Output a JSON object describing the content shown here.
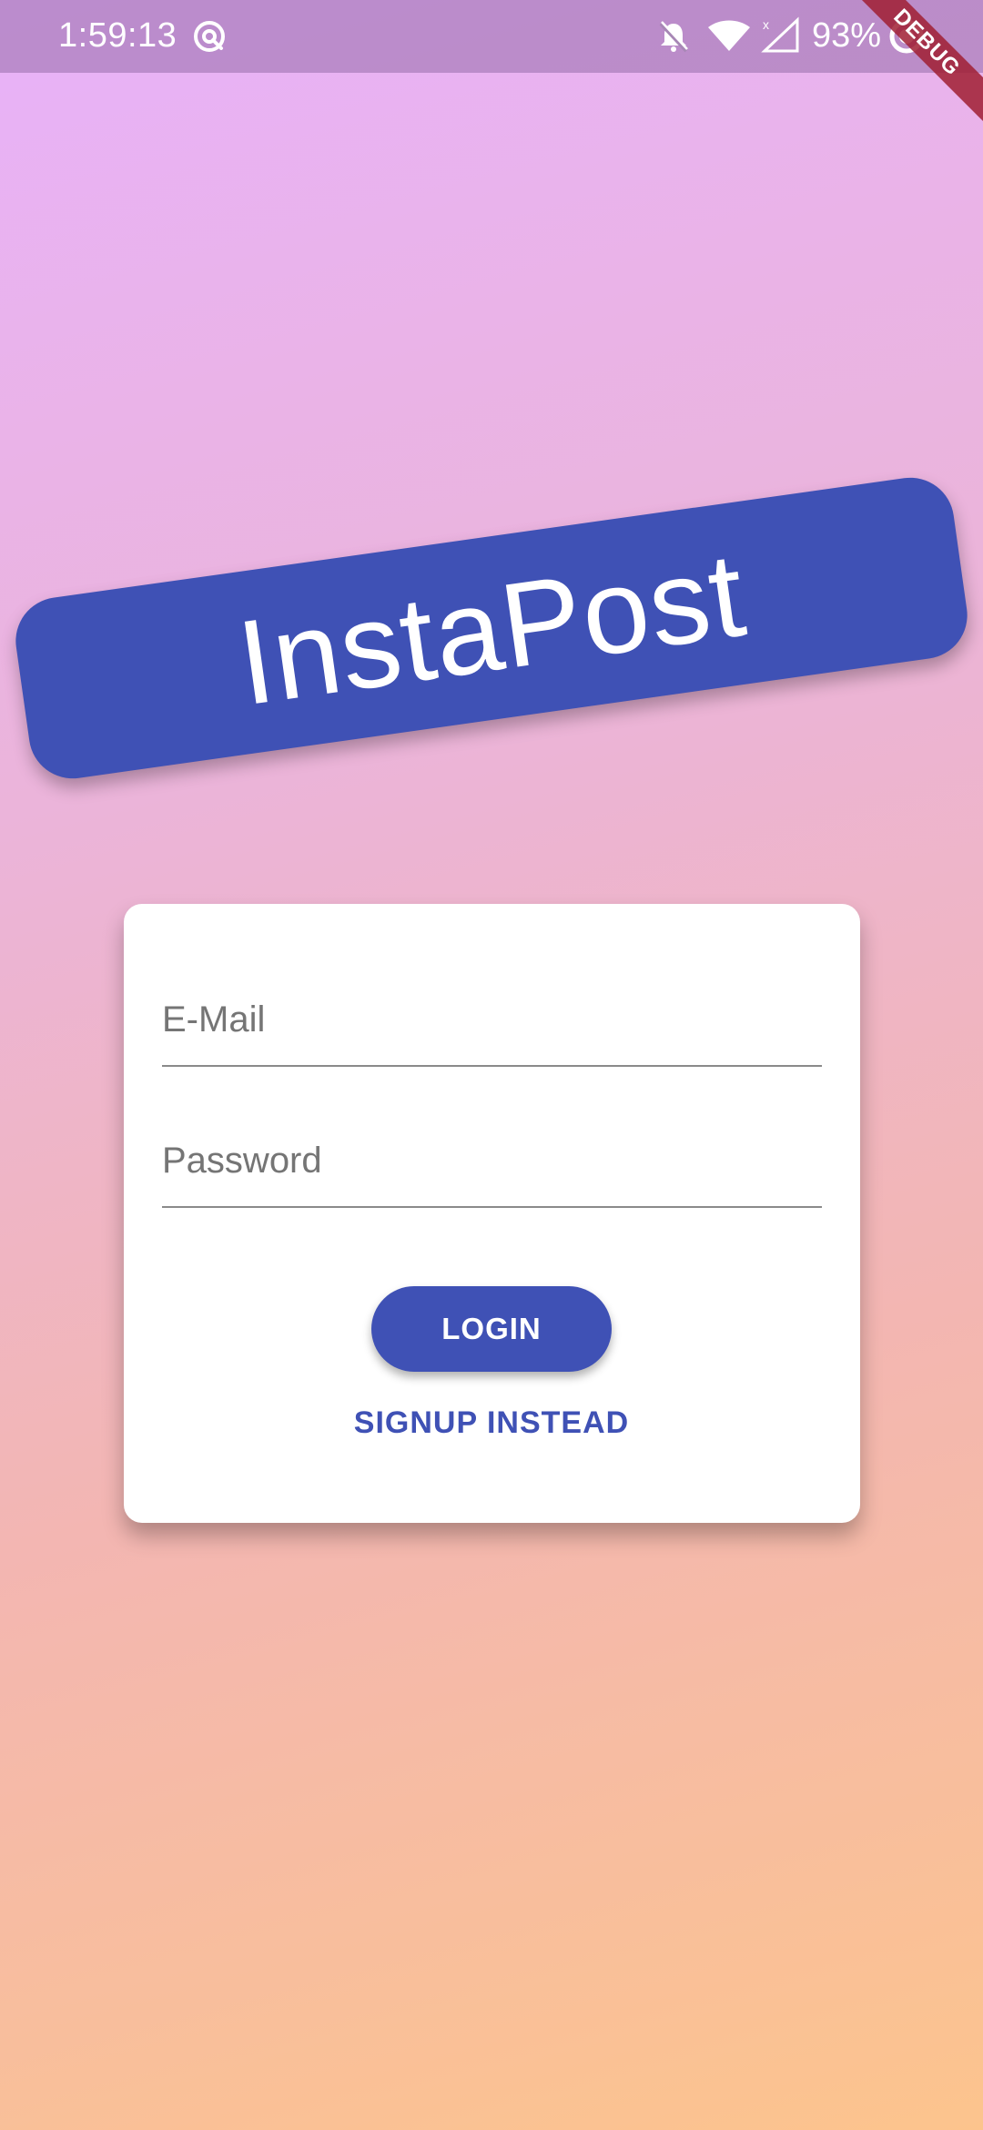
{
  "status_bar": {
    "time": "1:59:13",
    "battery": "93%",
    "icons": [
      "sync-icon",
      "bell-off-icon",
      "wifi-icon",
      "signal-icon",
      "battery-circle-icon"
    ]
  },
  "debug_banner": {
    "label": "DEBUG"
  },
  "app": {
    "title": "InstaPost"
  },
  "form": {
    "email_placeholder": "E-Mail",
    "password_placeholder": "Password",
    "login_label": "LOGIN",
    "signup_label": "SIGNUP INSTEAD"
  },
  "colors": {
    "primary": "#3f51b5",
    "gradient_top": "#e8b2f9",
    "gradient_bottom": "#fcc48d",
    "card": "#ffffff"
  }
}
